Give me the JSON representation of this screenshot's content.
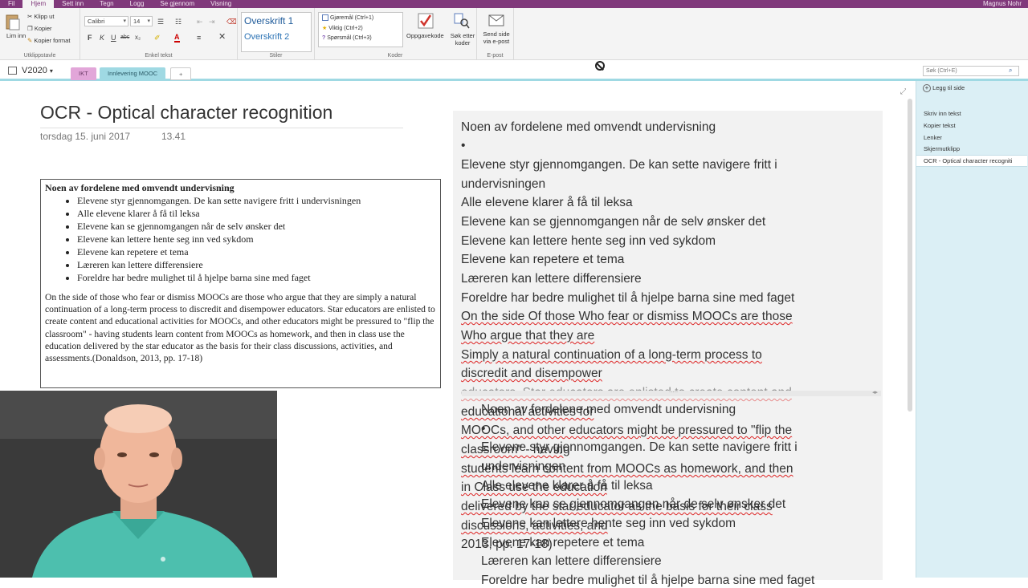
{
  "menu": {
    "tabs": [
      "Fil",
      "Hjem",
      "Sett inn",
      "Tegn",
      "Logg",
      "Se gjennom",
      "Visning"
    ],
    "active": "Hjem",
    "user": "Magnus Nohr"
  },
  "ribbon": {
    "clipboard": {
      "paste": "Lim inn",
      "cut": "Klipp ut",
      "copy": "Kopier",
      "format_painter": "Kopier format",
      "label": "Utklippstavle"
    },
    "font": {
      "family": "Calibri",
      "size": "14",
      "bold": "F",
      "italic": "K",
      "underline": "U",
      "strike": "abc",
      "label": "Enkel tekst"
    },
    "styles": {
      "h1": "Overskrift 1",
      "h2": "Overskrift 2",
      "label": "Stiler"
    },
    "tags": {
      "todo": "Gjøremål (Ctrl+1)",
      "important": "Viktig (Ctrl+2)",
      "question": "Spørsmål (Ctrl+3)",
      "label": "Koder"
    },
    "todo_tag": "Oppgavekode",
    "find_tags": "Søk etter koder",
    "email": "Send side via e-post",
    "email_label": "E-post"
  },
  "notebook": {
    "name": "V2020",
    "sections": [
      "IKT",
      "Innlevering MOOC"
    ],
    "add": "+",
    "search_placeholder": "Søk (Ctrl+E)"
  },
  "page": {
    "title": "OCR - Optical character recognition",
    "date": "torsdag 15. juni 2017",
    "time": "13.41"
  },
  "scan": {
    "heading": "Noen av fordelene med omvendt undervisning",
    "bullets": [
      "Elevene styr gjennomgangen. De kan sette navigere fritt i undervisningen",
      "Alle elevene klarer å få til leksa",
      "Elevene kan se gjennomgangen når de selv ønsker det",
      "Elevene kan lettere hente seg inn ved sykdom",
      "Elevene kan repetere et tema",
      "Læreren kan lettere differensiere",
      "Foreldre har bedre mulighet til å hjelpe barna sine med faget"
    ],
    "paragraph": "On the side of those who fear or dismiss MOOCs are those who argue that they are simply a natural continuation of a long-term process to discredit and disempower educators. Star educators are enlisted to create content and educational activities for MOOCs, and other educators might be pressured to \"flip the classroom\" - having students learn content from MOOCs as homework, and then in class use the education delivered by the star educator as the basis for their class discussions, activities, and assessments.(Donaldson, 2013, pp. 17-18)"
  },
  "ocr": {
    "lines": [
      "Noen av fordelene med omvendt undervisning",
      "•",
      "Elevene styr gjennomgangen. De kan sette navigere fritt i",
      "undervisningen",
      "Alle elevene klarer å få til leksa",
      "Elevene kan se gjennomgangen når de selv ønsker det",
      "Elevene kan lettere hente seg inn ved sykdom",
      "Elevene kan repetere et tema",
      "Læreren kan lettere differensiere",
      "Foreldre har bedre mulighet til å hjelpe barna sine med faget",
      "On the side Of those Who fear or dismiss MOOCs are those",
      "Who argue that they are",
      "Simply a natural continuation of a long-term process to",
      "discredit and disempower",
      "educators. Star educators are enlisted to create content and",
      "educational activities for",
      "MOOCs, and other educators might be pressured to \"flip the",
      "classroom\" - having",
      "students learn content from MOOCs as homework, and then",
      "in Class use the education",
      "delivered by the star educator as the basis for their class",
      "discussions, activities, and",
      "2013, pp. 17-18)"
    ],
    "overlay_lines": [
      "Noen av fordelene med omvendt undervisning",
      "•",
      "Elevene styr gjennomgangen. De kan sette navigere fritt i",
      "undervisningen",
      "Alle elevene klarer å få til leksa",
      "Elevene kan se gjennomgangen når de selv ønsker det",
      "Elevene kan lettere hente seg inn ved sykdom",
      "Elevene kan repetere et tema",
      "Læreren kan lettere differensiere",
      "Foreldre har bedre mulighet til å hjelpe barna sine med faget"
    ],
    "handle": "....."
  },
  "pane": {
    "add_page": "Legg til side",
    "pages": [
      "Skriv inn tekst",
      "Kopier tekst",
      "Lenker",
      "Skjermutklipp",
      "OCR - Optical character recogniti"
    ]
  },
  "colors": {
    "accent": "#80397b",
    "pane_bg": "#dbeff5",
    "section_ikt": "#e2a6d9",
    "section_mooc": "#9fd9e3"
  }
}
